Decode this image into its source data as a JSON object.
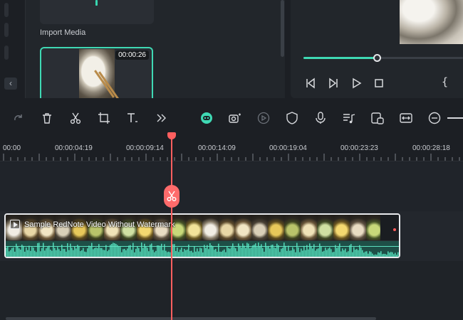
{
  "media_panel": {
    "import_label": "Import Media",
    "clip_duration": "00:00:26",
    "collapse_icon": "chevron-left-icon"
  },
  "preview": {
    "progress": 0.46,
    "mark_in_symbol": "{"
  },
  "toolbar": {
    "icons": [
      "redo-icon",
      "delete-icon",
      "cut-icon",
      "crop-icon",
      "text-icon",
      "more-icon",
      "ai-mask-icon",
      "camera-record-icon",
      "auto-reframe-icon",
      "shield-icon",
      "microphone-icon",
      "music-list-icon",
      "split-screen-icon",
      "audio-stretch-icon",
      "zoom-out-icon"
    ]
  },
  "ruler": {
    "ticks": [
      "00:00",
      "00:00:04:19",
      "00:00:09:14",
      "00:00:14:09",
      "00:00:19:04",
      "00:00:23:23",
      "00:00:28:18"
    ]
  },
  "timeline": {
    "clip_title": "Sample RedNote Video Without Watermark",
    "playhead_time_fraction": 0.47
  },
  "colors": {
    "accent": "#3fd9b4",
    "playhead": "#ff5f5f",
    "background": "#1c1f24"
  }
}
